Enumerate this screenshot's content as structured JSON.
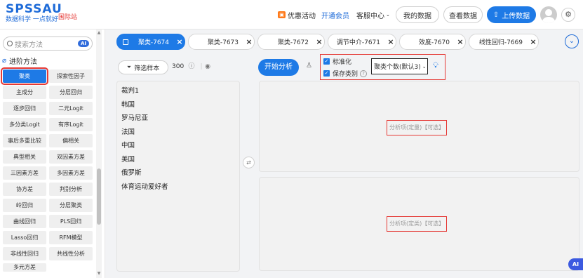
{
  "header": {
    "logo_title": "SPSSAU",
    "logo_subtitle": "数据科学 一点就好",
    "intl_link": "国际站",
    "promo": "优惠活动",
    "vip": "开通会员",
    "service": "客服中心",
    "my_data": "我的数据",
    "view_data": "查看数据",
    "upload": "上传数据"
  },
  "sidebar": {
    "search_placeholder": "搜索方法",
    "search_ai": "AI",
    "section_title": "进阶方法",
    "methods": [
      [
        "聚类",
        "探索性因子"
      ],
      [
        "主成分",
        "分层回归"
      ],
      [
        "逐步回归",
        "二元Logit"
      ],
      [
        "多分类Logit",
        "有序Logit"
      ],
      [
        "事后多重比较",
        "偏相关"
      ],
      [
        "典型相关",
        "双因素方差"
      ],
      [
        "三因素方差",
        "多因素方差"
      ],
      [
        "协方差",
        "判别分析"
      ],
      [
        "岭回归",
        "分层聚类"
      ],
      [
        "曲线回归",
        "PLS回归"
      ],
      [
        "Lasso回归",
        "RFM模型"
      ],
      [
        "非线性回归",
        "共线性分析"
      ],
      [
        "多元方差",
        ""
      ]
    ],
    "active_method": "聚类"
  },
  "tabs": [
    {
      "label": "聚类-7674",
      "active": true
    },
    {
      "label": "聚类-7673",
      "active": false
    },
    {
      "label": "聚类-7672",
      "active": false
    },
    {
      "label": "调节中介-7671",
      "active": false
    },
    {
      "label": "效度-7670",
      "active": false
    },
    {
      "label": "线性回归-7669",
      "active": false
    }
  ],
  "variables": {
    "filter_label": "筛选样本",
    "count": "300",
    "items": [
      "裁判1",
      "韩国",
      "罗马尼亚",
      "法国",
      "中国",
      "美国",
      "俄罗斯",
      "体育运动爱好者"
    ]
  },
  "analysis": {
    "start_label": "开始分析",
    "standardize": "标准化",
    "save_category": "保存类别",
    "cluster_count": "聚类个数(默认3)",
    "hint_quantitative": "分析项(定量)【可选】",
    "hint_categorical": "分析项(定类)【可选】"
  },
  "ai_float": "AI"
}
